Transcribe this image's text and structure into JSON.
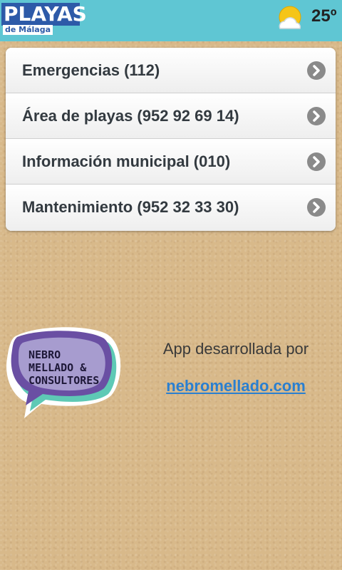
{
  "header": {
    "logo_title": "PLAYAS",
    "logo_subtitle": "de Málaga",
    "weather_icon": "partly-cloudy-icon",
    "temperature": "25º"
  },
  "contacts": [
    {
      "label": "Emergencias (112)",
      "icon": "chevron-right-icon"
    },
    {
      "label": "Área de playas (952 92 69 14)",
      "icon": "chevron-right-icon"
    },
    {
      "label": "Información municipal (010)",
      "icon": "chevron-right-icon"
    },
    {
      "label": "Mantenimiento (952 32 33 30)",
      "icon": "chevron-right-icon"
    }
  ],
  "credits": {
    "badge_lines": [
      "NEBRO",
      "MELLADO &",
      "CONSULTORES"
    ],
    "developed_by": "App desarrollada por",
    "link": "nebromellado.com"
  },
  "colors": {
    "header_bg": "#5fc6d3",
    "logo_blue": "#2d5aa8",
    "link": "#2a7fd0",
    "badge_purple": "#6a4fa3",
    "badge_teal": "#5ec9b5"
  }
}
